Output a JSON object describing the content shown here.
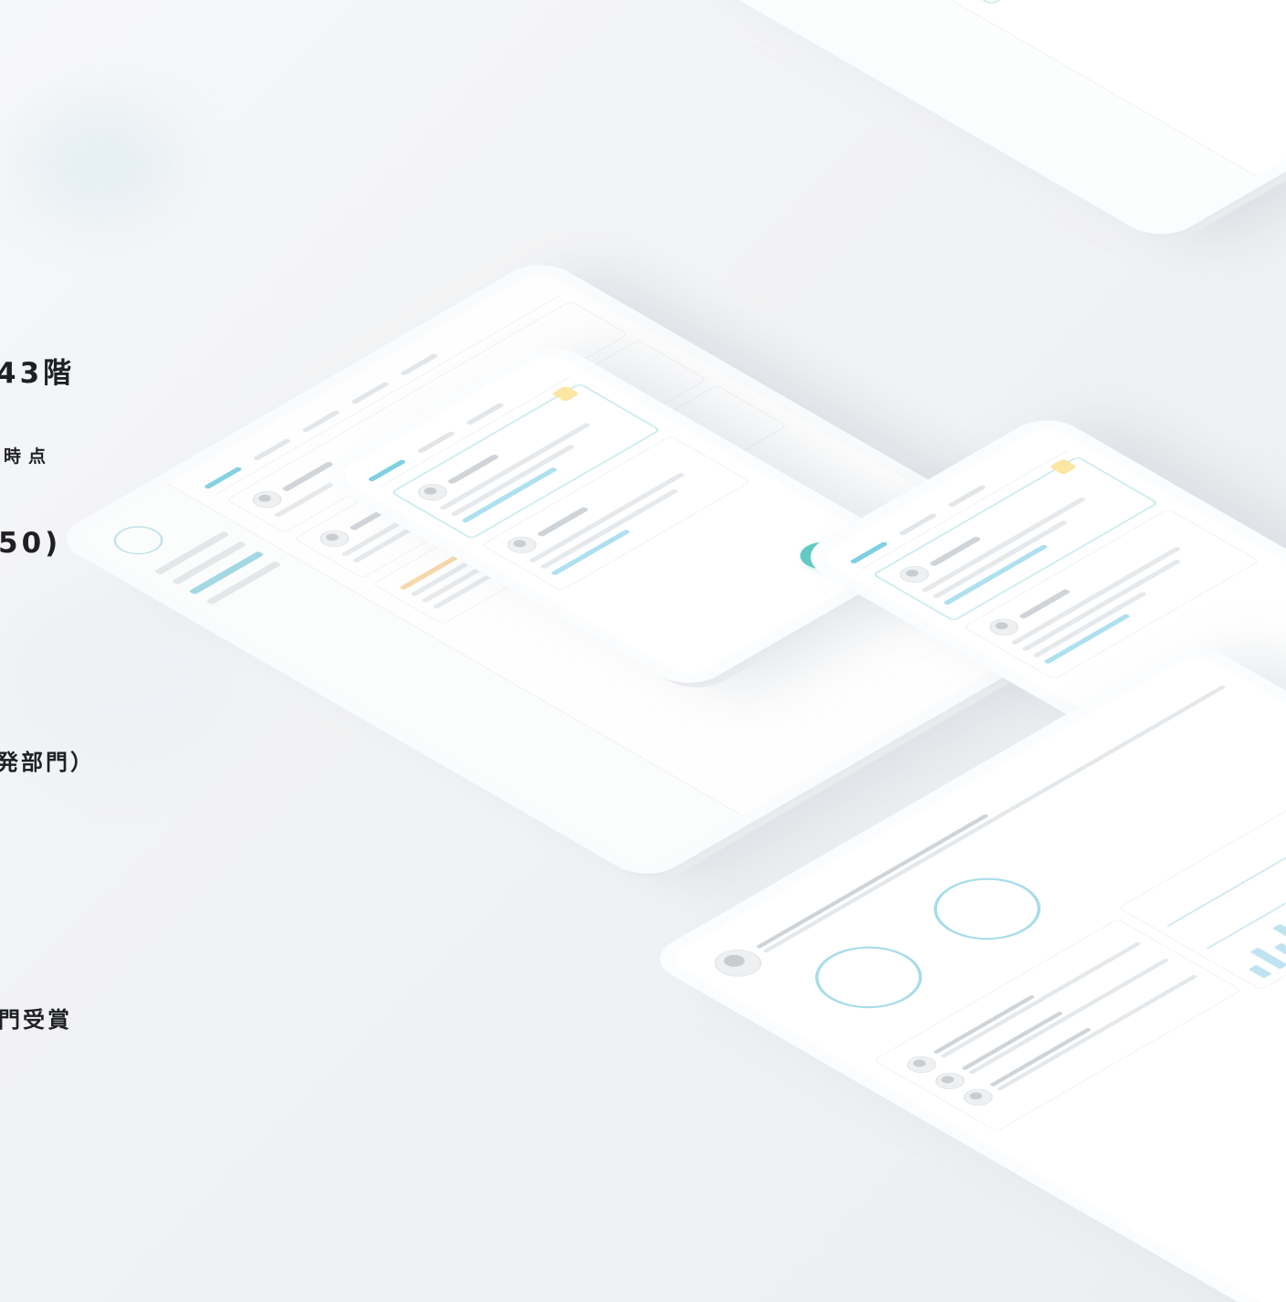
{
  "left_text": {
    "floor": "43階",
    "point": "時点",
    "count": "50)",
    "dept": "発部門）",
    "award": "門受賞"
  },
  "colors": {
    "accent": "#62c9c3",
    "highlight_border": "#c9ecef",
    "link": "#aee0f0",
    "badge": "#fbe6a2"
  },
  "icons": [
    "send-icon",
    "reply-icon",
    "avatar-icon",
    "search-icon",
    "bell-icon",
    "ring-chart-icon"
  ]
}
